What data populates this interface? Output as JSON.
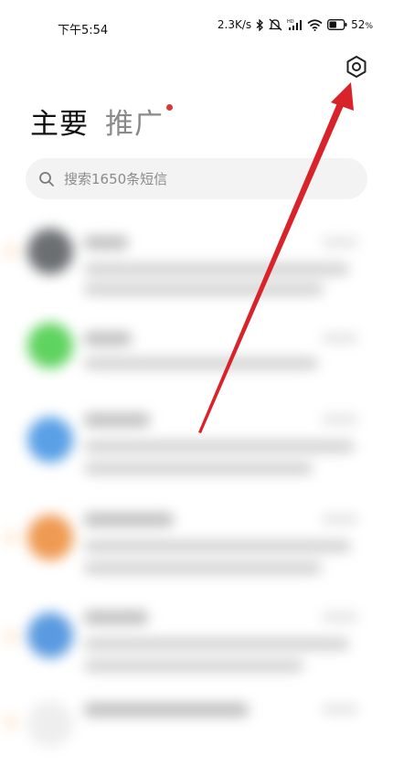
{
  "status_bar": {
    "time": "下午5:54",
    "network_speed": "2.3K/s",
    "battery_percent": "52",
    "battery_unit": "%",
    "icons": [
      "bluetooth-icon",
      "mute-icon",
      "hd-signal-icon",
      "wifi-icon",
      "battery-icon"
    ]
  },
  "header": {
    "tabs": [
      {
        "label": "主要",
        "active": true
      },
      {
        "label": "推广",
        "active": false,
        "has_badge": true
      }
    ],
    "settings_icon": "gear-icon"
  },
  "search": {
    "placeholder": "搜索1650条短信",
    "icon": "search-icon"
  },
  "messages": {
    "avatar_colors": [
      "#6b6f72",
      "#5fd35f",
      "#5aa0e6",
      "#ef9a52",
      "#5a9ae0",
      "#eeeeee"
    ]
  },
  "annotation": {
    "arrow_color": "#d8232a"
  }
}
